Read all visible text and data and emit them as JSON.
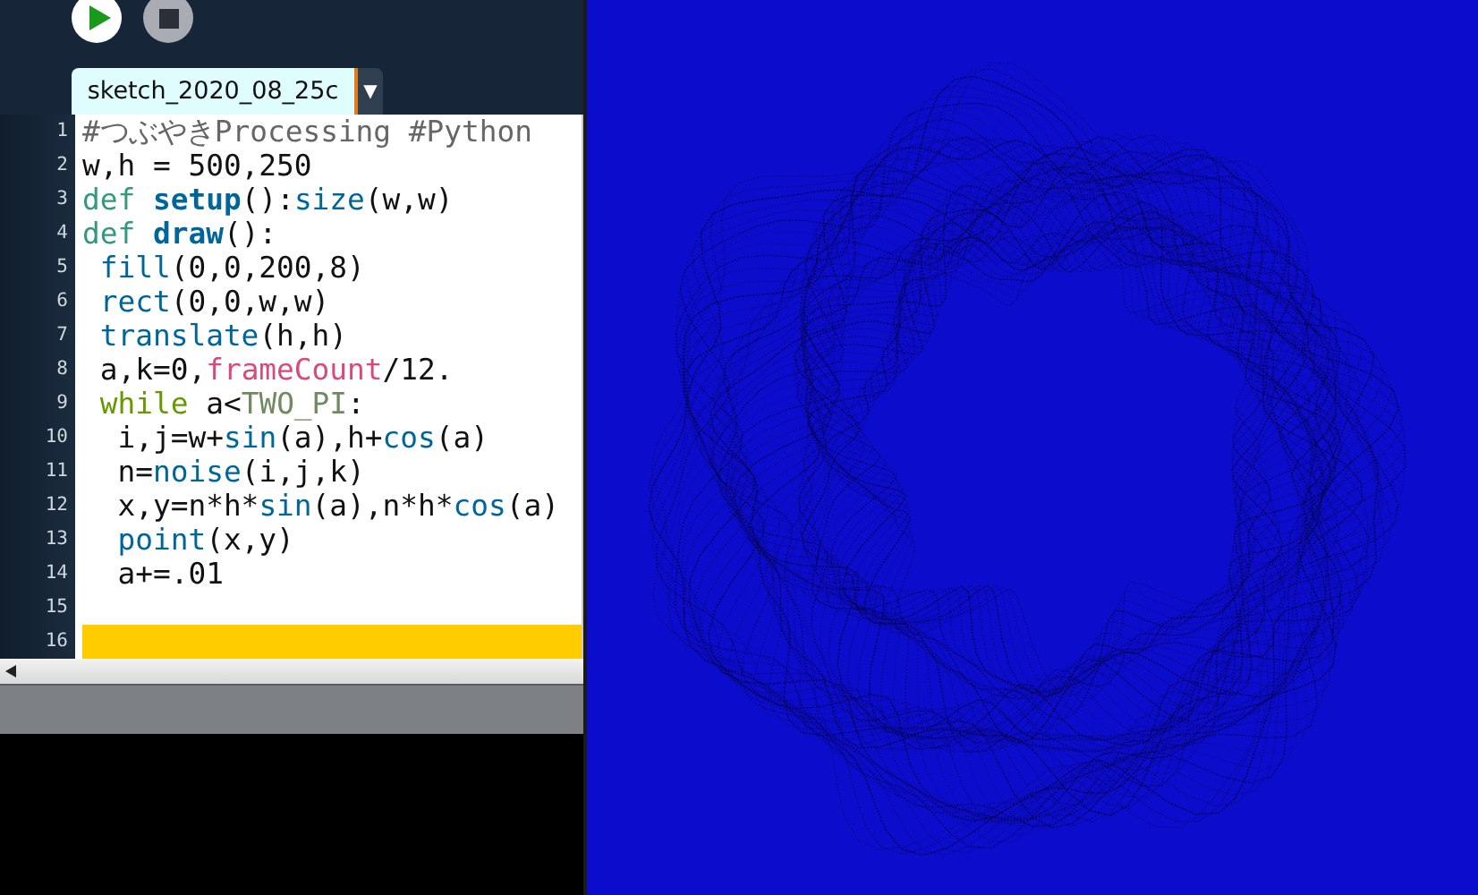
{
  "toolbar": {
    "buttons": [
      {
        "kind": "run"
      },
      {
        "kind": "stop"
      }
    ]
  },
  "tabs": [
    {
      "label": "sketch_2020_08_25c",
      "selected": true
    }
  ],
  "tab_menu": {
    "label": "▼"
  },
  "editor": {
    "lines": [
      {
        "number": "1",
        "current": false,
        "tokens": [
          {
            "kind": "comment",
            "text": "#つぶやきProcessing #Python"
          }
        ]
      },
      {
        "number": "2",
        "current": false,
        "tokens": [
          {
            "kind": "plain",
            "text": "w,h = 500,250"
          }
        ]
      },
      {
        "number": "3",
        "current": false,
        "tokens": [
          {
            "kind": "keyword",
            "text": "def "
          },
          {
            "kind": "definition",
            "text": "setup"
          },
          {
            "kind": "plain",
            "text": "():"
          },
          {
            "kind": "function",
            "text": "size"
          },
          {
            "kind": "plain",
            "text": "(w,w)"
          }
        ]
      },
      {
        "number": "4",
        "current": false,
        "tokens": [
          {
            "kind": "keyword",
            "text": "def "
          },
          {
            "kind": "definition",
            "text": "draw"
          },
          {
            "kind": "plain",
            "text": "():"
          }
        ]
      },
      {
        "number": "5",
        "current": false,
        "tokens": [
          {
            "kind": "function",
            "text": " fill"
          },
          {
            "kind": "plain",
            "text": "(0,0,200,8)"
          }
        ]
      },
      {
        "number": "6",
        "current": false,
        "tokens": [
          {
            "kind": "function",
            "text": " rect"
          },
          {
            "kind": "plain",
            "text": "(0,0,w,w)"
          }
        ]
      },
      {
        "number": "7",
        "current": false,
        "tokens": [
          {
            "kind": "function",
            "text": " translate"
          },
          {
            "kind": "plain",
            "text": "(h,h)"
          }
        ]
      },
      {
        "number": "8",
        "current": false,
        "tokens": [
          {
            "kind": "plain",
            "text": " a,k=0,"
          },
          {
            "kind": "variable",
            "text": "frameCount"
          },
          {
            "kind": "plain",
            "text": "/12."
          }
        ]
      },
      {
        "number": "9",
        "current": false,
        "tokens": [
          {
            "kind": "control",
            "text": " while"
          },
          {
            "kind": "plain",
            "text": " a<"
          },
          {
            "kind": "constant",
            "text": "TWO_PI"
          },
          {
            "kind": "plain",
            "text": ":"
          }
        ]
      },
      {
        "number": "10",
        "current": false,
        "tokens": [
          {
            "kind": "plain",
            "text": "  i,j=w+"
          },
          {
            "kind": "function",
            "text": "sin"
          },
          {
            "kind": "plain",
            "text": "(a),h+"
          },
          {
            "kind": "function",
            "text": "cos"
          },
          {
            "kind": "plain",
            "text": "(a)"
          }
        ]
      },
      {
        "number": "11",
        "current": false,
        "tokens": [
          {
            "kind": "plain",
            "text": "  n="
          },
          {
            "kind": "function",
            "text": "noise"
          },
          {
            "kind": "plain",
            "text": "(i,j,k)"
          }
        ]
      },
      {
        "number": "12",
        "current": false,
        "tokens": [
          {
            "kind": "plain",
            "text": "  x,y=n*h*"
          },
          {
            "kind": "function",
            "text": "sin"
          },
          {
            "kind": "plain",
            "text": "(a),n*h*"
          },
          {
            "kind": "function",
            "text": "cos"
          },
          {
            "kind": "plain",
            "text": "(a)"
          }
        ]
      },
      {
        "number": "13",
        "current": false,
        "tokens": [
          {
            "kind": "function",
            "text": "  point"
          },
          {
            "kind": "plain",
            "text": "(x,y)"
          }
        ]
      },
      {
        "number": "14",
        "current": false,
        "tokens": [
          {
            "kind": "plain",
            "text": "  a+=.01"
          }
        ]
      },
      {
        "number": "15",
        "current": false
      },
      {
        "number": "16",
        "current": true
      }
    ]
  }
}
